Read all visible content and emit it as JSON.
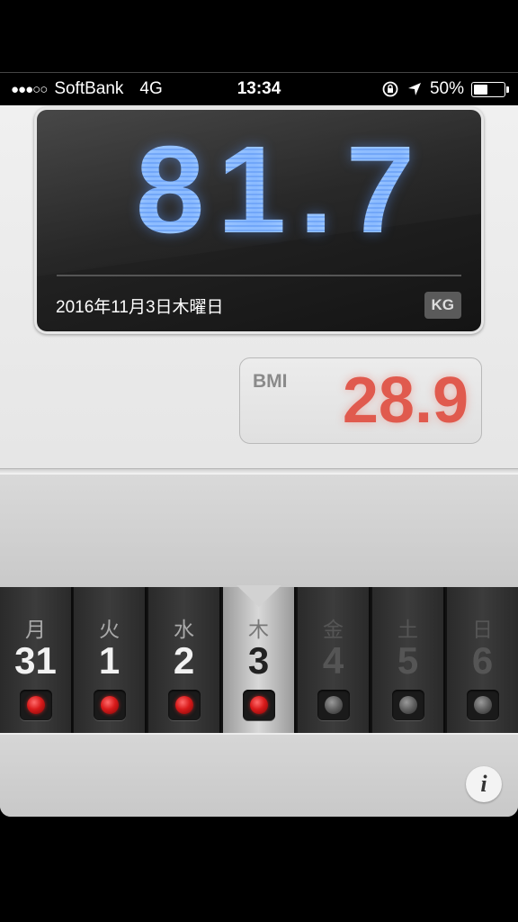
{
  "status_bar": {
    "signal_dots": "●●●○○",
    "carrier": "SoftBank",
    "network": "4G",
    "time": "13:34",
    "battery_percent": "50%",
    "battery_level": 0.5
  },
  "display": {
    "weight": "81.7",
    "date": "2016年11月3日木曜日",
    "unit": "KG"
  },
  "bmi": {
    "label": "BMI",
    "value": "28.9"
  },
  "week": {
    "days": [
      {
        "kanji": "月",
        "num": "31",
        "state": "recorded"
      },
      {
        "kanji": "火",
        "num": "1",
        "state": "recorded"
      },
      {
        "kanji": "水",
        "num": "2",
        "state": "recorded"
      },
      {
        "kanji": "木",
        "num": "3",
        "state": "selected"
      },
      {
        "kanji": "金",
        "num": "4",
        "state": "future"
      },
      {
        "kanji": "土",
        "num": "5",
        "state": "future"
      },
      {
        "kanji": "日",
        "num": "6",
        "state": "future"
      }
    ],
    "selected_index": 3
  },
  "info_button": {
    "label": "i"
  },
  "colors": {
    "weight": "#9cc6ff",
    "bmi": "#e05a4e",
    "led_on": "#d91b1b"
  }
}
